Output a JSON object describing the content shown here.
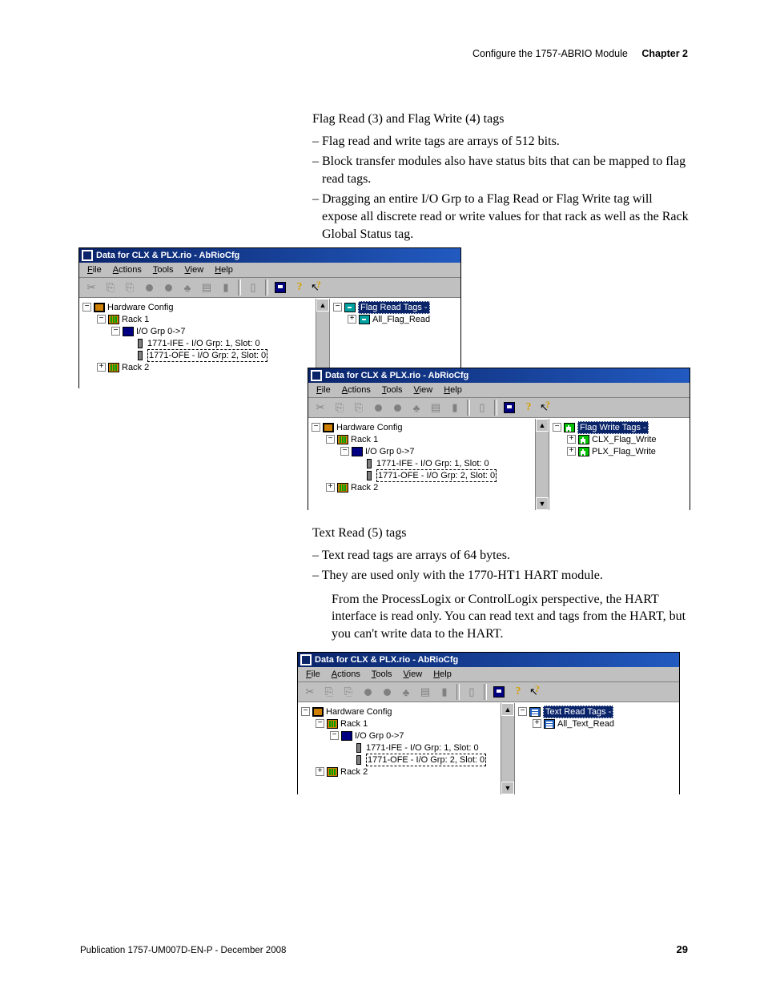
{
  "header": {
    "section": "Configure the 1757-ABRIO Module",
    "chapter": "Chapter 2"
  },
  "flag": {
    "heading": "Flag Read (3) and Flag Write (4) tags",
    "bullets": [
      "Flag read and write tags are arrays of 512 bits.",
      "Block transfer modules also have status bits that can be mapped to flag read tags.",
      "Dragging an entire I/O Grp to a Flag Read or Flag Write tag will expose all discrete read or write values for that rack as well as the Rack Global Status tag."
    ]
  },
  "textread": {
    "heading": "Text Read (5) tags",
    "bullets": [
      "Text read tags are arrays of 64 bytes.",
      "They are used only with the 1770-HT1 HART module."
    ],
    "follow": "From the ProcessLogix or ControlLogix perspective, the HART interface is read only. You can read text and tags from the HART, but you can't write data to the HART."
  },
  "win": {
    "title": "Data for CLX & PLX.rio - AbRioCfg",
    "menus": {
      "file": "File",
      "actions": "Actions",
      "tools": "Tools",
      "view": "View",
      "help": "Help"
    },
    "hw": {
      "root": "Hardware Config",
      "rack1": "Rack 1",
      "grp": "I/O Grp 0->7",
      "mod1": "1771-IFE - I/O Grp: 1, Slot: 0",
      "mod2": "1771-OFE - I/O Grp: 2, Slot: 0",
      "rack2": "Rack 2"
    },
    "flagread": {
      "root": "Flag Read Tags -",
      "item": "All_Flag_Read"
    },
    "flagwrite": {
      "root": "Flag Write Tags -",
      "items": [
        "CLX_Flag_Write",
        "PLX_Flag_Write"
      ]
    },
    "textread": {
      "root": "Text Read Tags -",
      "item": "All_Text_Read"
    }
  },
  "footer": {
    "pub": "Publication 1757-UM007D-EN-P - December 2008",
    "page": "29"
  }
}
